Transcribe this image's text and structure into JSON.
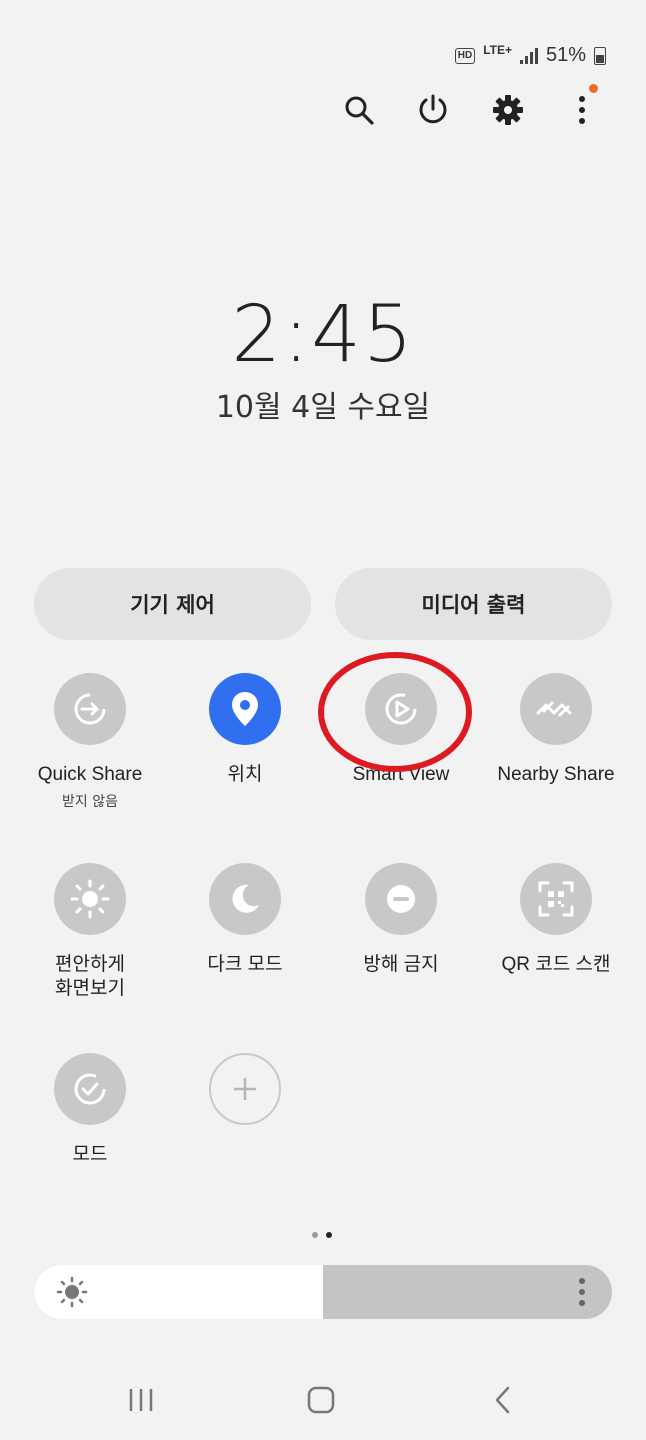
{
  "status_bar": {
    "hd": "HD",
    "network": "LTE+",
    "battery_percent": "51%",
    "battery_level": 0.51
  },
  "top_actions": [
    {
      "icon": "search-icon"
    },
    {
      "icon": "power-icon"
    },
    {
      "icon": "gear-icon"
    },
    {
      "icon": "more-vert-icon",
      "has_notification": true
    }
  ],
  "clock": {
    "time": "2:45",
    "date": "10월 4일 수요일"
  },
  "panels": {
    "device_control": "기기 제어",
    "media_output": "미디어 출력"
  },
  "tiles": [
    {
      "label": "Quick Share",
      "sub": "받지 않음",
      "icon": "quick-share-icon",
      "active": false
    },
    {
      "label": "위치",
      "sub": "",
      "icon": "location-pin-icon",
      "active": true
    },
    {
      "label": "Smart View",
      "sub": "",
      "icon": "smart-view-icon",
      "active": false
    },
    {
      "label": "Nearby Share",
      "sub": "",
      "icon": "nearby-share-icon",
      "active": false
    },
    {
      "label": "편안하게 화면보기",
      "sub": "",
      "icon": "eye-comfort-icon",
      "active": false
    },
    {
      "label": "다크 모드",
      "sub": "",
      "icon": "moon-icon",
      "active": false
    },
    {
      "label": "방해 금지",
      "sub": "",
      "icon": "do-not-disturb-icon",
      "active": false
    },
    {
      "label": "QR 코드 스캔",
      "sub": "",
      "icon": "qr-scan-icon",
      "active": false
    },
    {
      "label": "모드",
      "sub": "",
      "icon": "modes-icon",
      "active": false
    },
    {
      "label": "",
      "sub": "",
      "icon": "add-icon",
      "active": false
    }
  ],
  "pager": {
    "pages": 2,
    "current": 2
  },
  "brightness": {
    "level": 0.5
  },
  "colors": {
    "accent": "#2f6ff0",
    "annotation_ring": "#dd1a22",
    "notification_dot": "#ee6a2a",
    "tile_inactive": "#c8c8c8"
  },
  "navigation": [
    {
      "icon": "recent-apps-icon"
    },
    {
      "icon": "home-icon"
    },
    {
      "icon": "back-icon"
    }
  ]
}
